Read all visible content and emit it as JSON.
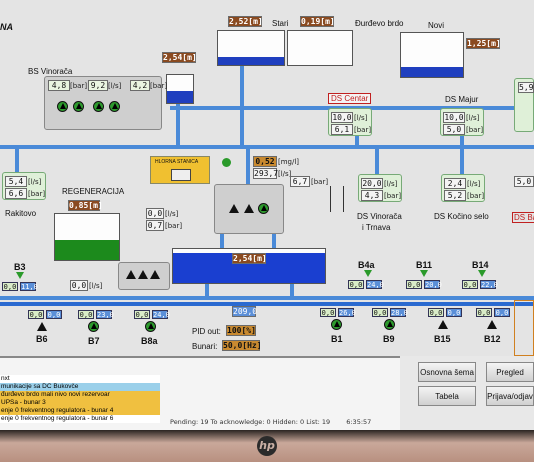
{
  "app": {
    "title_fragment": "NA"
  },
  "reservoirs": {
    "stari_level": "2,52[m]",
    "stari_level2": "0,19[m]",
    "stari_label": "Stari",
    "durdevo_label": "Đurđevo brdo",
    "novi_label": "Novi",
    "novi_level": "1,25[m]",
    "mid_tank_level": "2,54[m]"
  },
  "bs_vinoraca": {
    "label": "BS Vinorača",
    "pressure1": "4,8",
    "unit1": "[bar]",
    "flow": "9,2",
    "unit_flow": "[l/s]",
    "pressure2": "4,2",
    "unit2": "[bar]"
  },
  "ds_centar": {
    "label": "DS Centar",
    "flow": "10,0",
    "pressure": "6,1",
    "unit_flow": "[l/s]",
    "unit_pressure": "[bar]"
  },
  "ds_majur": {
    "label": "DS Majur",
    "flow": "10,0",
    "pressure": "5,0",
    "unit_flow": "[l/s]",
    "unit_pressure": "[bar]"
  },
  "right_edge": {
    "value1": "5,9",
    "value2": "5,0",
    "label": "DS Ba"
  },
  "rakitovo": {
    "label": "Rakitovo",
    "flow": "5,4",
    "pressure": "6,6",
    "unit_flow": "[l/s]",
    "unit_pressure": "[bar]"
  },
  "chlorine": {
    "label": "HLORNA STANICA",
    "value": "0,52",
    "unit": "[mg/l]"
  },
  "treatment": {
    "flow_total": "293,7",
    "unit_flow": "[l/s]",
    "pressure": "6,7",
    "unit_pressure": "[bar]"
  },
  "regeneracija": {
    "label": "REGENERACIJA",
    "level": "0,85[m]",
    "flow": "0,0",
    "unit_flow": "[l/s]",
    "pressure": "0,7",
    "unit_pressure": "[bar]",
    "flow2": "0,0",
    "unit_flow2": "[l/s]"
  },
  "ds_vinoraca_trnava": {
    "label_line1": "DS Vinorača",
    "label_line2": "i Trnava",
    "flow": "20,0",
    "pressure": "4,3",
    "unit_flow": "[l/s]",
    "unit_pressure": "[bar]"
  },
  "ds_kocino_selo": {
    "label": "DS Kočino selo",
    "flow": "2,4",
    "pressure": "5,2",
    "unit_flow": "[l/s]",
    "unit_pressure": "[bar]"
  },
  "big_tank": {
    "level": "2,54[m]",
    "flow_out": "209,0"
  },
  "wells": [
    {
      "name": "B3",
      "v1": "0,0",
      "v2": "11,0"
    },
    {
      "name": "B4a",
      "v1": "0,0",
      "v2": "24,0"
    },
    {
      "name": "B11",
      "v1": "0,0",
      "v2": "20,0"
    },
    {
      "name": "B14",
      "v1": "0,0",
      "v2": "22,0"
    },
    {
      "name": "B6",
      "v1": "0,0",
      "v2": "0,0"
    },
    {
      "name": "B7",
      "v1": "0,0",
      "v2": "23,0"
    },
    {
      "name": "B8a",
      "v1": "0,0",
      "v2": "24,0"
    },
    {
      "name": "B1",
      "v1": "0,0",
      "v2": "26,0"
    },
    {
      "name": "B9",
      "v1": "0,0",
      "v2": "28,0"
    },
    {
      "name": "B15",
      "v1": "0,0",
      "v2": "0,0"
    },
    {
      "name": "B12",
      "v1": "0,0",
      "v2": "0,0"
    }
  ],
  "pid": {
    "label_out": "PID out:",
    "out_value": "100[%]",
    "label_bunari": "Bunari:",
    "bunari_value": "50,0[Hz]"
  },
  "alarms": [
    {
      "text": "nxt",
      "color": "#ffffff"
    },
    {
      "text": "munikacije sa DC Bukovče",
      "color": "#9bd0ea"
    },
    {
      "text": "đurđevo brdo mali nivo novi rezervoar",
      "color": "#f0c040"
    },
    {
      "text": "UPSa - bunar 3",
      "color": "#f0c040"
    },
    {
      "text": "enje      0   frekventnog regulatora - bunar 4",
      "color": "#f0c040"
    },
    {
      "text": "enje      0   frekventnog regulatora - bunar 6",
      "color": "#ffffff"
    }
  ],
  "status_bar": "Pending: 19   To acknowledge: 0   Hidden: 0   List: 19",
  "clock": "6:35:57",
  "buttons": {
    "osnovna_sema": "Osnovna šema",
    "pregled_alarma": "Pregled alarm",
    "tabela": "Tabela",
    "prijava": "Prijava/odjav"
  },
  "bezel_logo": "hp"
}
